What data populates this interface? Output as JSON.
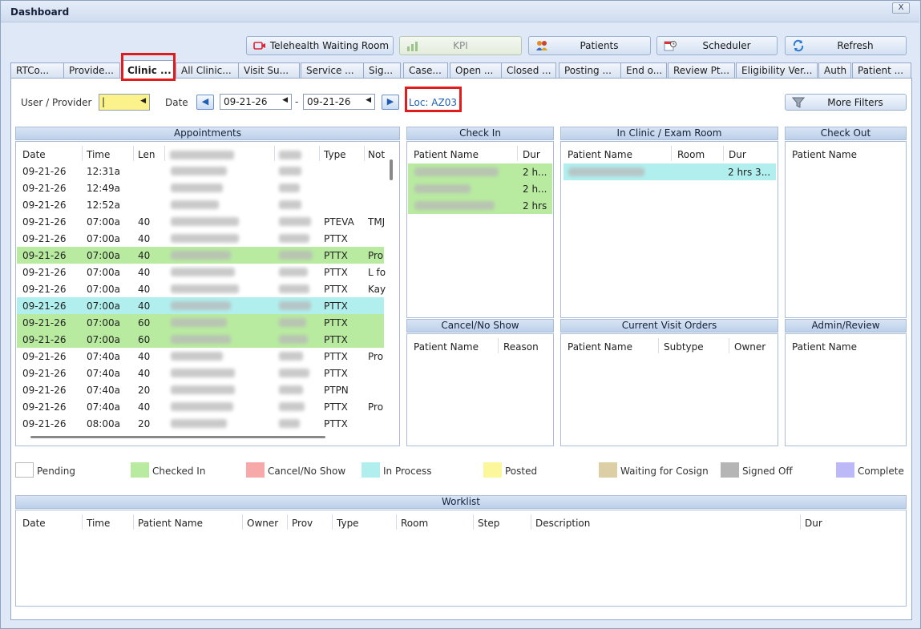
{
  "window": {
    "title": "Dashboard",
    "close_label": "X"
  },
  "toolbar": {
    "telehealth": "Telehealth Waiting Room",
    "kpi": "KPI",
    "patients": "Patients",
    "scheduler": "Scheduler",
    "refresh": "Refresh"
  },
  "tabs": [
    {
      "label": "RTCo..."
    },
    {
      "label": "Provide..."
    },
    {
      "label": "Clinic ..."
    },
    {
      "label": "All Clinic..."
    },
    {
      "label": "Visit Su..."
    },
    {
      "label": "Service ..."
    },
    {
      "label": "Sig..."
    },
    {
      "label": "Case..."
    },
    {
      "label": "Open ..."
    },
    {
      "label": "Closed ..."
    },
    {
      "label": "Posting ..."
    },
    {
      "label": "End o..."
    },
    {
      "label": "Review Pt..."
    },
    {
      "label": "Eligibility Ver..."
    },
    {
      "label": "Auth"
    },
    {
      "label": "Patient ..."
    }
  ],
  "filters": {
    "user_label": "User / Provider",
    "user_value": "|",
    "date_label": "Date",
    "date_from": "09-21-26",
    "date_sep": "-",
    "date_to": "09-21-26",
    "location": "Loc: AZ03",
    "more_filters": "More Filters"
  },
  "appointments": {
    "title": "Appointments",
    "columns": [
      "Date",
      "Time",
      "Len",
      "",
      "",
      "Type",
      "Not"
    ],
    "rows": [
      {
        "date": "09-21-26",
        "time": "12:31a",
        "len": "",
        "type": "",
        "note": "",
        "status": "pending"
      },
      {
        "date": "09-21-26",
        "time": "12:49a",
        "len": "",
        "type": "",
        "note": "",
        "status": "pending"
      },
      {
        "date": "09-21-26",
        "time": "12:52a",
        "len": "",
        "type": "",
        "note": "",
        "status": "pending"
      },
      {
        "date": "09-21-26",
        "time": "07:00a",
        "len": "40",
        "type": "PTEVA",
        "note": "TMJ",
        "status": "pending"
      },
      {
        "date": "09-21-26",
        "time": "07:00a",
        "len": "40",
        "type": "PTTX",
        "note": "",
        "status": "pending"
      },
      {
        "date": "09-21-26",
        "time": "07:00a",
        "len": "40",
        "type": "PTTX",
        "note": "Pro",
        "status": "checked-in"
      },
      {
        "date": "09-21-26",
        "time": "07:00a",
        "len": "40",
        "type": "PTTX",
        "note": "L fo",
        "status": "pending"
      },
      {
        "date": "09-21-26",
        "time": "07:00a",
        "len": "40",
        "type": "PTTX",
        "note": "Kay",
        "status": "pending"
      },
      {
        "date": "09-21-26",
        "time": "07:00a",
        "len": "40",
        "type": "PTTX",
        "note": "",
        "status": "in-process"
      },
      {
        "date": "09-21-26",
        "time": "07:00a",
        "len": "60",
        "type": "PTTX",
        "note": "",
        "status": "checked-in"
      },
      {
        "date": "09-21-26",
        "time": "07:00a",
        "len": "60",
        "type": "PTTX",
        "note": "",
        "status": "checked-in"
      },
      {
        "date": "09-21-26",
        "time": "07:40a",
        "len": "40",
        "type": "PTTX",
        "note": "Pro",
        "status": "pending"
      },
      {
        "date": "09-21-26",
        "time": "07:40a",
        "len": "40",
        "type": "PTTX",
        "note": "",
        "status": "pending"
      },
      {
        "date": "09-21-26",
        "time": "07:40a",
        "len": "20",
        "type": "PTPN",
        "note": "",
        "status": "pending"
      },
      {
        "date": "09-21-26",
        "time": "07:40a",
        "len": "40",
        "type": "PTTX",
        "note": "Pro",
        "status": "pending"
      },
      {
        "date": "09-21-26",
        "time": "08:00a",
        "len": "20",
        "type": "PTTX",
        "note": "",
        "status": "pending"
      }
    ]
  },
  "check_in": {
    "title": "Check In",
    "columns": [
      "Patient Name",
      "Dur"
    ],
    "rows": [
      {
        "dur": "2 h..."
      },
      {
        "dur": "2 h..."
      },
      {
        "dur": "2 hrs"
      }
    ]
  },
  "in_clinic": {
    "title": "In Clinic / Exam Room",
    "columns": [
      "Patient Name",
      "Room",
      "Dur"
    ],
    "rows": [
      {
        "dur": "2 hrs 3..."
      }
    ]
  },
  "check_out": {
    "title": "Check Out",
    "columns": [
      "Patient Name"
    ]
  },
  "cancel_no_show": {
    "title": "Cancel/No Show",
    "columns": [
      "Patient Name",
      "Reason"
    ]
  },
  "current_visit_orders": {
    "title": "Current Visit Orders",
    "columns": [
      "Patient Name",
      "Subtype",
      "Owner"
    ]
  },
  "admin_review": {
    "title": "Admin/Review",
    "columns": [
      "Patient Name"
    ]
  },
  "legend": [
    {
      "label": "Pending",
      "color": "#ffffff"
    },
    {
      "label": "Checked In",
      "color": "#b8eba0"
    },
    {
      "label": "Cancel/No Show",
      "color": "#f7a9a9"
    },
    {
      "label": "In Process",
      "color": "#b1efef"
    },
    {
      "label": "Posted",
      "color": "#fbf79a"
    },
    {
      "label": "Waiting for Cosign",
      "color": "#dccfa6"
    },
    {
      "label": "Signed Off",
      "color": "#b5b5b5"
    },
    {
      "label": "Complete",
      "color": "#bdb8f8"
    }
  ],
  "worklist": {
    "title": "Worklist",
    "columns": [
      "Date",
      "Time",
      "Patient Name",
      "Owner",
      "Prov",
      "Type",
      "Room",
      "Step",
      "Description",
      "Dur"
    ]
  },
  "colors": {
    "checked_in": "#b8eba0",
    "in_process": "#b1efef",
    "highlight": "#e11c1c",
    "location_text": "#1f5fb3",
    "user_field": "#fbf28b"
  }
}
